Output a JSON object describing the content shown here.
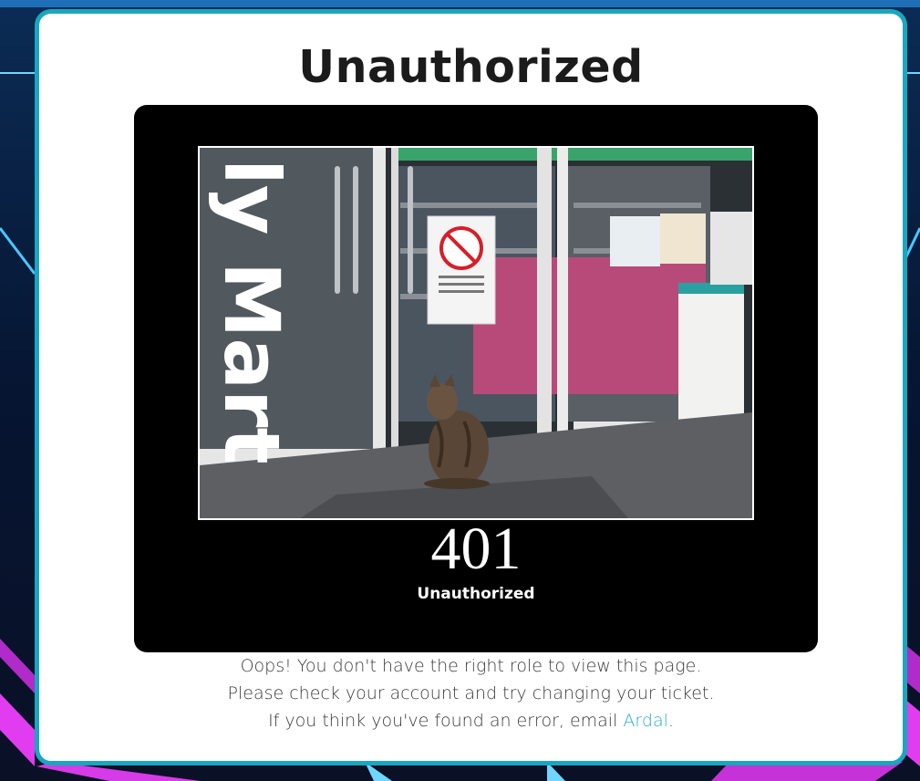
{
  "page": {
    "title": "Unauthorized"
  },
  "poster": {
    "code": "401",
    "code_label": "Unauthorized",
    "photo_sign_text": "ly Mart"
  },
  "message": {
    "line1": "Oops! You don't have the right role to view this page.",
    "line2": "Please check your account and try changing your ticket.",
    "line3_prefix": "If you think you've found an error, email ",
    "line3_link": "Ardal",
    "line3_suffix": "."
  },
  "colors": {
    "card_border": "#19a7c0",
    "link": "#2aa9d6",
    "poster_bg": "#000000",
    "background": "#06122a"
  }
}
